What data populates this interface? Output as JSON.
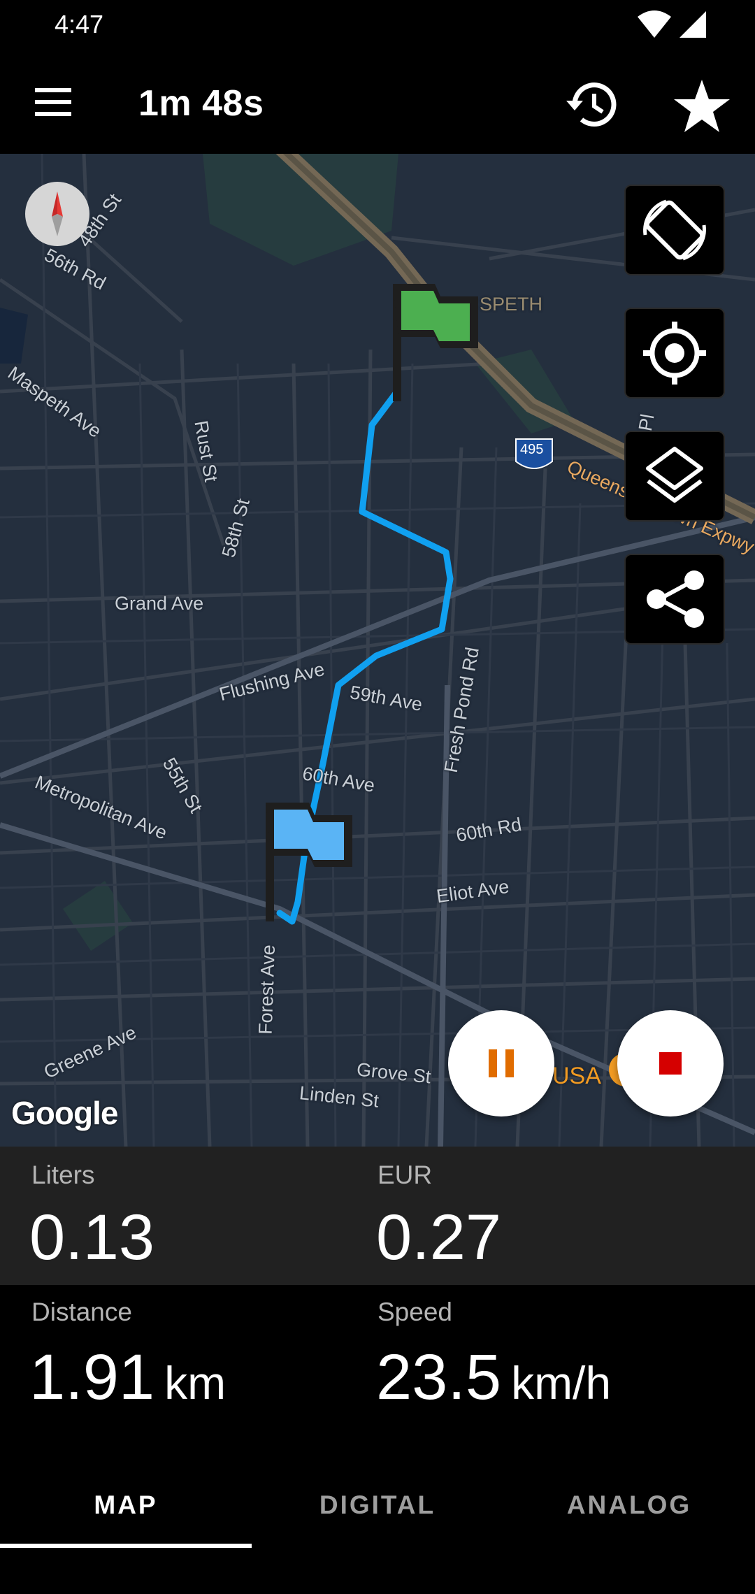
{
  "status_bar": {
    "time": "4:47",
    "icons": [
      "wifi-icon",
      "cell-signal-icon"
    ]
  },
  "header": {
    "title": "1m 48s",
    "icons": [
      "menu-icon",
      "history-icon",
      "star-icon"
    ]
  },
  "map": {
    "labels": {
      "l48th": "48th St",
      "l56thrd": "56th Rd",
      "maspeth_ave": "Maspeth Ave",
      "rust": "Rust St",
      "s58th": "58th St",
      "grand": "Grand Ave",
      "flushing": "Flushing Ave",
      "ave59": "59th Ave",
      "fresh_pond": "Fresh Pond Rd",
      "ave60": "60th Ave",
      "rd60": "60th Rd",
      "s55th": "55th St",
      "metropolitan": "Metropolitan Ave",
      "eliot": "Eliot Ave",
      "forest": "Forest Ave",
      "greene": "Greene Ave",
      "grove": "Grove St",
      "linden": "Linden St",
      "maspeth": "SPETH",
      "pl": "h Pl",
      "expressway": "Queens Midtown Expwy",
      "shield": "495",
      "poi": "USA"
    },
    "google_logo": "Google",
    "controls": [
      "screen-rotation-icon",
      "my-location-icon",
      "layers-icon",
      "share-icon"
    ],
    "start_flag_color": "#4caf50",
    "end_flag_color": "#5ab4f5",
    "route_color": "#10a0f0"
  },
  "stats": {
    "liters": {
      "label": "Liters",
      "value": "0.13"
    },
    "eur": {
      "label": "EUR",
      "value": "0.27"
    },
    "distance": {
      "label": "Distance",
      "value": "1.91",
      "unit": "km"
    },
    "speed": {
      "label": "Speed",
      "value": "23.5",
      "unit": "km/h"
    }
  },
  "tabs": [
    {
      "label": "MAP",
      "active": true
    },
    {
      "label": "DIGITAL",
      "active": false
    },
    {
      "label": "ANALOG",
      "active": false
    }
  ],
  "colors": {
    "pause_accent": "#e06c00",
    "stop_accent": "#d50000",
    "map_bg": "#242f3e"
  }
}
